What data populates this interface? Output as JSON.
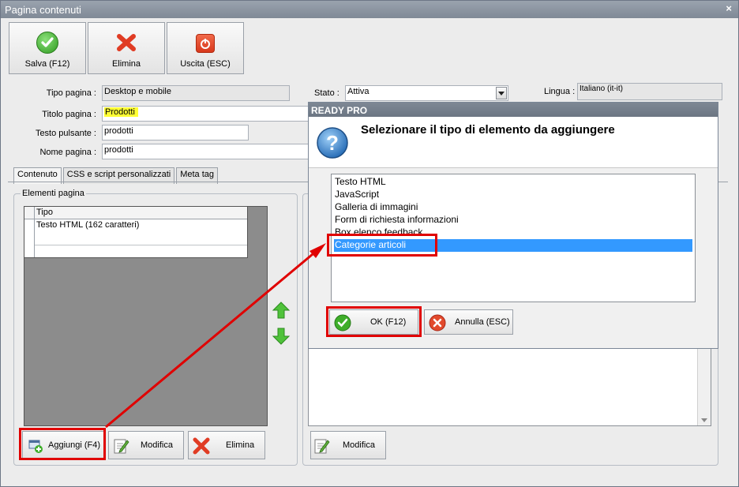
{
  "window": {
    "title": "Pagina contenuti",
    "close_glyph": "×"
  },
  "toolbar": {
    "save_label": "Salva (F12)",
    "delete_label": "Elimina",
    "exit_label": "Uscita (ESC)"
  },
  "form": {
    "page_type_label": "Tipo pagina :",
    "page_type_value": "Desktop e mobile",
    "title_label": "Titolo pagina :",
    "title_value": "Prodotti",
    "button_text_label": "Testo pulsante :",
    "button_text_value": "prodotti",
    "page_name_label": "Nome pagina :",
    "page_name_value": "prodotti",
    "status_label": "Stato :",
    "status_value": "Attiva",
    "language_label": "Lingua :",
    "language_value": "Italiano (it-it)"
  },
  "tabs": [
    "Contenuto",
    "CSS e script personalizzati",
    "Meta tag"
  ],
  "elements_group": {
    "title": "Elementi pagina",
    "column_header": "Tipo",
    "rows": [
      "Testo HTML (162 caratteri)"
    ]
  },
  "bottom_buttons": {
    "add_label": "Aggiungi (F4)",
    "edit_label": "Modifica",
    "delete_label": "Elimina",
    "edit_right_label": "Modifica"
  },
  "dialog": {
    "title": "READY PRO",
    "question": "Selezionare il tipo di elemento da aggiungere",
    "options": [
      "Testo HTML",
      "JavaScript",
      "Galleria di immagini",
      "Form di richiesta informazioni",
      "Box elenco feedback",
      "Categorie articoli"
    ],
    "selected_option": "Categorie articoli",
    "ok_label": "OK (F12)",
    "cancel_label": "Annulla (ESC)"
  },
  "icons": [
    "check-icon",
    "x-icon",
    "power-icon",
    "question-icon",
    "arrow-up-icon",
    "arrow-down-icon",
    "add-item-icon",
    "edit-icon",
    "chevron-down-icon"
  ],
  "colors": {
    "highlight": "#ffff33",
    "selection": "#3399ff",
    "annotation": "#e00000",
    "green": "#33a620",
    "red": "#e03c24"
  }
}
